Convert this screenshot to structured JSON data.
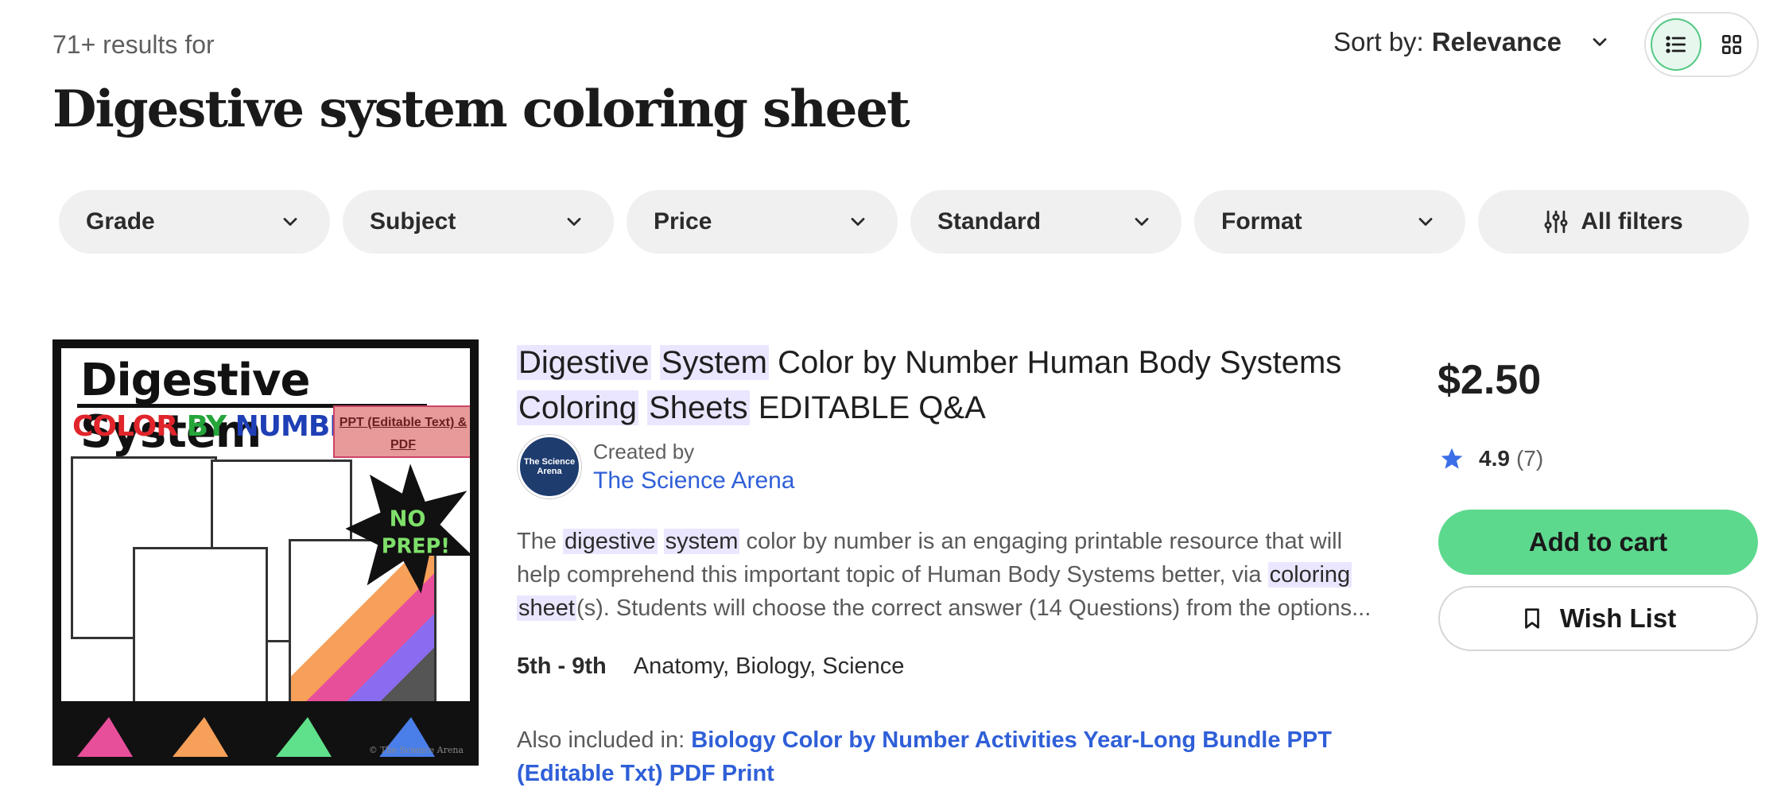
{
  "header": {
    "results_count": "71+ results for",
    "query_title": "Digestive system coloring sheet",
    "sort_label": "Sort by:",
    "sort_value": "Relevance"
  },
  "view_toggle": {
    "active": "list",
    "icons": [
      "list-view-icon",
      "grid-view-icon"
    ]
  },
  "filters": [
    {
      "label": "Grade"
    },
    {
      "label": "Subject"
    },
    {
      "label": "Price"
    },
    {
      "label": "Standard"
    },
    {
      "label": "Format"
    },
    {
      "label": "All filters"
    }
  ],
  "product": {
    "thumbnail": {
      "title": "Digestive System",
      "subtitle_1": "COLOR",
      "subtitle_2": "BY",
      "subtitle_3": "NUMBER",
      "badge": "PPT (Editable Text) & PDF",
      "star_text_1": "NO",
      "star_text_2": "PREP!",
      "copyright": "© The Science Arena"
    },
    "title_hl_1": "Digestive",
    "title_hl_2": "System",
    "title_mid": "Color by Number Human Body Systems",
    "title_hl_3": "Coloring",
    "title_hl_4": "Sheets",
    "title_end": "EDITABLE Q&A",
    "creator_avatar_text": "The Science Arena",
    "created_by_label": "Created by",
    "creator_name": "The Science Arena",
    "desc": {
      "p1": "The",
      "hl1": "digestive",
      "hl2": "system",
      "p2": "color by number is an engaging printable resource that will help comprehend this important topic of Human Body Systems better, via",
      "hl3": "coloring",
      "hl4": "sheet",
      "p3": "(s). Students will choose the correct answer (14 Questions) from the options..."
    },
    "grades": "5th - 9th",
    "subjects": "Anatomy, Biology, Science",
    "also_label": "Also included in:",
    "also_link": "Biology Color by Number Activities Year-Long Bundle PPT (Editable Txt) PDF Print",
    "price": "$2.50",
    "rating_score": "4.9",
    "rating_count": "(7)",
    "add_to_cart": "Add to cart",
    "wish_list": "Wish List"
  },
  "colors": {
    "accent_green": "#5dd98e",
    "link_blue": "#2f5fd8",
    "star_blue": "#3a6fe8",
    "highlight": "#ebe6ff"
  }
}
